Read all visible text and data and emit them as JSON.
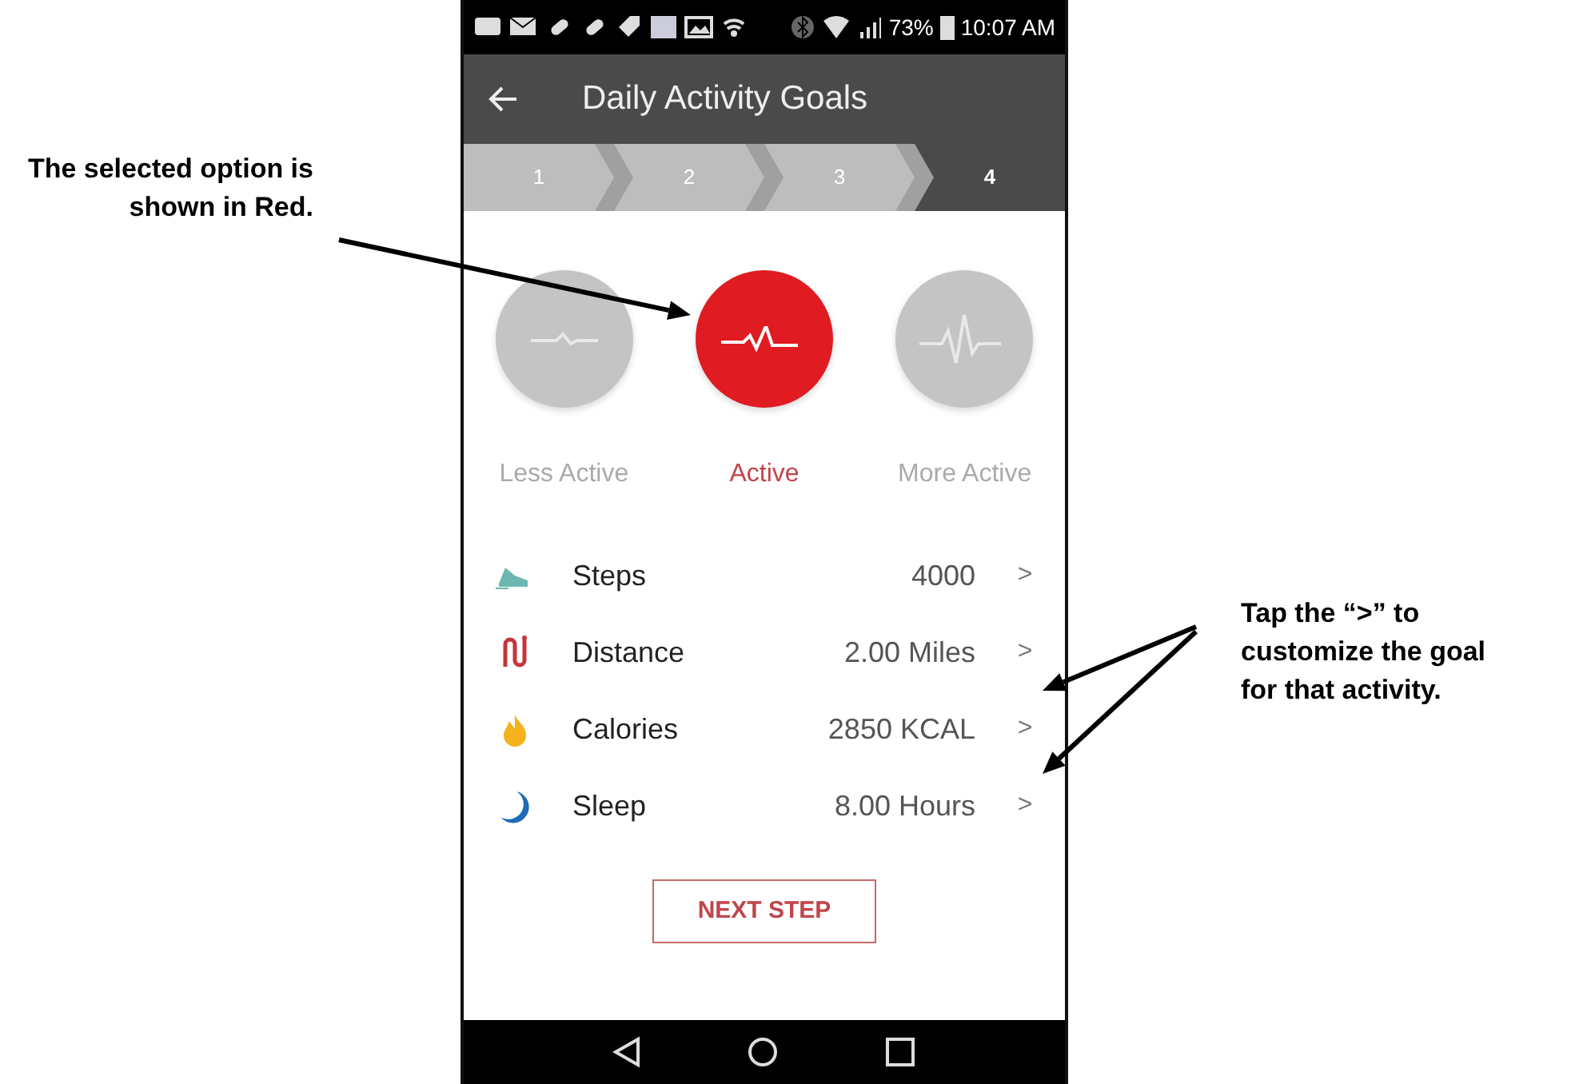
{
  "left_annotation": "The selected option is shown in Red.",
  "right_annotation": "Tap the “>” to customize the goal for that activity.",
  "status_bar": {
    "battery": "73%",
    "time": "10:07 AM"
  },
  "app_bar": {
    "title": "Daily Activity Goals"
  },
  "stepper": [
    {
      "label": "1",
      "selected": false
    },
    {
      "label": "2",
      "selected": false
    },
    {
      "label": "3",
      "selected": false
    },
    {
      "label": "4",
      "selected": true
    }
  ],
  "activity_levels": [
    {
      "label": "Less Active",
      "selected": false
    },
    {
      "label": "Active",
      "selected": true
    },
    {
      "label": "More Active",
      "selected": false
    }
  ],
  "goals": [
    {
      "kind": "steps",
      "name": "Steps",
      "value": "4000",
      "chevron": ">"
    },
    {
      "kind": "distance",
      "name": "Distance",
      "value": "2.00 Miles",
      "chevron": ">"
    },
    {
      "kind": "calories",
      "name": "Calories",
      "value": "2850 KCAL",
      "chevron": ">"
    },
    {
      "kind": "sleep",
      "name": "Sleep",
      "value": "8.00 Hours",
      "chevron": ">"
    }
  ],
  "button": "NEXT STEP"
}
